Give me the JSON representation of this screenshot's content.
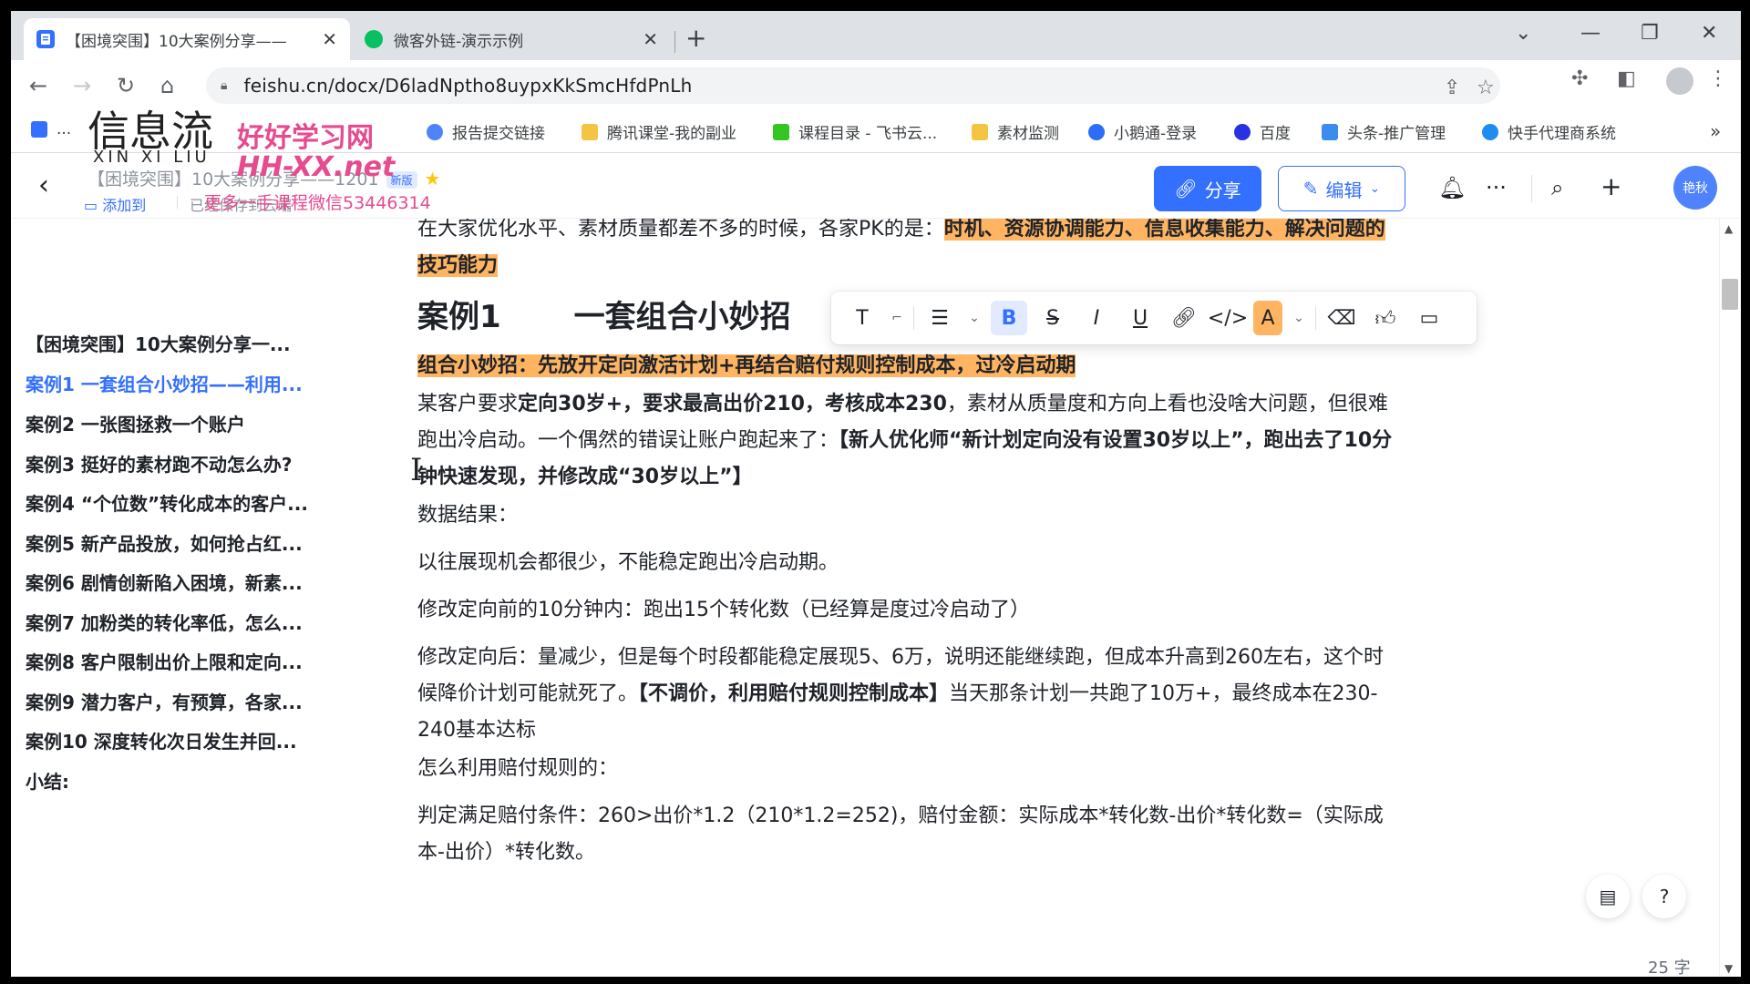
{
  "browser": {
    "tabs": [
      {
        "title": "【困境突围】10大案例分享——",
        "favicon": "feishu-doc-icon",
        "active": true
      },
      {
        "title": "微客外链-演示示例",
        "favicon": "wechat-icon",
        "active": false
      }
    ],
    "url": "feishu.cn/docx/D6ladNptho8uypxKkSmcHfdPnLh",
    "bookmarks": [
      {
        "label": "...",
        "icon": "doc-icon"
      },
      {
        "label": "报告提交链接",
        "icon": "link-icon"
      },
      {
        "label": "腾讯课堂-我的副业",
        "icon": "folder-icon"
      },
      {
        "label": "课程目录 - 飞书云...",
        "icon": "sheet-icon"
      },
      {
        "label": "素材监测",
        "icon": "folder-icon"
      },
      {
        "label": "小鹅通-登录",
        "icon": "xiaoe-icon"
      },
      {
        "label": "百度",
        "icon": "baidu-icon"
      },
      {
        "label": "头条-推广管理",
        "icon": "toutiao-icon"
      },
      {
        "label": "快手代理商系统",
        "icon": "kuaishou-icon"
      }
    ],
    "bookmarks_more": "»"
  },
  "watermark": {
    "cn": "信息流",
    "pinyin": "XIN XI LIU",
    "line1": "好好学习网",
    "line2": "HH-XX.net",
    "line3": "更多一手课程微信53446314"
  },
  "header": {
    "doc_title": "【困境突围】10大案例分享——1201",
    "badge": "新版",
    "add_to": "添加到",
    "saved": "已经保存到云端",
    "share": "分享",
    "edit": "编辑",
    "avatar": "艳秋"
  },
  "outline": [
    {
      "label": "【困境突围】10大案例分享一...",
      "active": false
    },
    {
      "label": "案例1 一套组合小妙招——利用...",
      "active": true
    },
    {
      "label": "案例2 一张图拯救一个账户",
      "active": false
    },
    {
      "label": "案例3 挺好的素材跑不动怎么办?",
      "active": false
    },
    {
      "label": "案例4 “个位数”转化成本的客户...",
      "active": false
    },
    {
      "label": "案例5 新产品投放，如何抢占红...",
      "active": false
    },
    {
      "label": "案例6 剧情创新陷入困境，新素...",
      "active": false
    },
    {
      "label": "案例7 加粉类的转化率低，怎么...",
      "active": false
    },
    {
      "label": "案例8 客户限制出价上限和定向...",
      "active": false
    },
    {
      "label": "案例9 潜力客户，有预算，各家...",
      "active": false
    },
    {
      "label": "案例10 深度转化次日发生并回...",
      "active": false
    },
    {
      "label": "小结:",
      "active": false
    }
  ],
  "doc": {
    "intro_plain": "在大家优化水平、素材质量都差不多的时候，各家PK的是：",
    "intro_hl": "时机、资源协调能力、信息收集能力、解决问题的技巧能力",
    "h2_num": "案例1",
    "h2_title": "一套组合小妙招",
    "combo": "组合小妙招：先放开定向激活计划+再结合赔付规则控制成本，过冷启动期",
    "p1_a": "某客户要求",
    "p1_b": "定向30岁+，要求最高出价210，考核成本230",
    "p1_c": "，素材从质量度和方向上看也没啥大问题，但很难跑出冷启动。一个偶然的错误让账户跑起来了：",
    "p1_d": "【新人优化师“新计划定向没有设置30岁以上”，跑出去了10分钟快速发现，并修改成“30岁以上”】",
    "p2": "数据结果：",
    "p3": "以往展现机会都很少，不能稳定跑出冷启动期。",
    "p4": "修改定向前的10分钟内：跑出15个转化数（已经算是度过冷启动了）",
    "p5_a": "修改定向后：量减少，但是每个时段都能稳定展现5、6万，说明还能继续跑，但成本升高到260左右，这个时候降价计划可能就死了。",
    "p5_b": "【不调价，利用赔付规则控制成本】",
    "p5_c": "当天那条计划一共跑了10万+，最终成本在230-240基本达标",
    "p6": "怎么利用赔付规则的：",
    "p7": "判定满足赔付条件：260>出价*1.2（210*1.2=252)，赔付金额：实际成本*转化数-出价*转化数=（实际成本-出价）*转化数。"
  },
  "word_count": "25 字",
  "colors": {
    "accent": "#3370ff",
    "highlight": "#ffb462",
    "watermark": "#e64a8f"
  }
}
